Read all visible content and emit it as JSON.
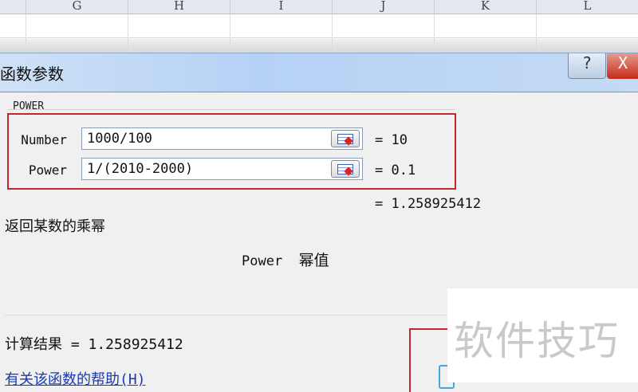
{
  "sheet": {
    "columns": [
      "G",
      "H",
      "I",
      "J",
      "K",
      "L"
    ]
  },
  "dialog": {
    "title": "函数参数",
    "help_button": "?",
    "close_button": "X",
    "function_name": "POWER",
    "args": [
      {
        "label": "Number",
        "value": "1000/100",
        "result": "=  10"
      },
      {
        "label": "Power",
        "value": "1/(2010-2000)",
        "result": "=  0.1"
      }
    ],
    "formula_result": "=  1.258925412",
    "description": "返回某数的乘幂",
    "param_name": "Power",
    "param_desc": "幂值",
    "calc_result": "计算结果 =  1.258925412",
    "help_link": "有关该函数的帮助(H)"
  },
  "watermark": "软件技巧"
}
